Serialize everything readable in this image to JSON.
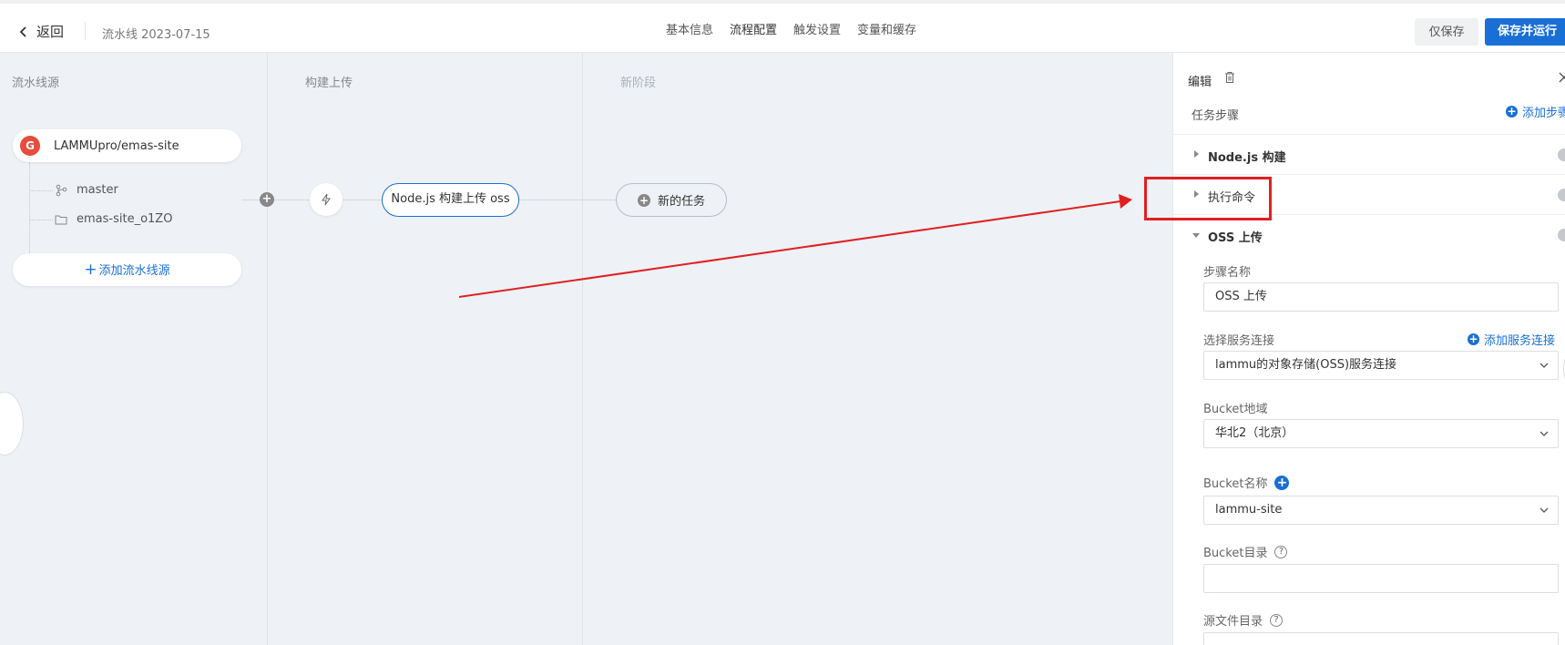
{
  "header": {
    "back_label": "返回",
    "pipeline_name": "流水线 2023-07-15",
    "tabs": [
      {
        "label": "基本信息"
      },
      {
        "label": "流程配置"
      },
      {
        "label": "触发设置"
      },
      {
        "label": "变量和缓存"
      }
    ],
    "active_tab": "流程配置",
    "save_only_label": "仅保存",
    "save_run_label": "保存并运行"
  },
  "canvas": {
    "stages": [
      {
        "title": "流水线源"
      },
      {
        "title": "构建上传"
      },
      {
        "title": "新阶段"
      }
    ],
    "source": {
      "logo_letter": "G",
      "repo": "LAMMUpro/emas-site",
      "branch": "master",
      "workdir": "emas-site_o1ZO"
    },
    "add_source_label": "添加流水线源",
    "task_label": "Node.js 构建上传 oss",
    "new_task_label": "新的任务"
  },
  "panel": {
    "title": "编辑",
    "steps_header": "任务步骤",
    "add_step_label": "添加步骤",
    "steps": [
      {
        "label": "Node.js 构建"
      },
      {
        "label": "执行命令"
      },
      {
        "label": "OSS 上传"
      }
    ],
    "form": {
      "step_name_label": "步骤名称",
      "step_name_value": "OSS 上传",
      "service_label": "选择服务连接",
      "add_service_label": "添加服务连接",
      "service_value": "lammu的对象存储(OSS)服务连接",
      "region_label": "Bucket地域",
      "region_value": "华北2（北京）",
      "bucket_name_label": "Bucket名称",
      "bucket_name_value": "lammu-site",
      "bucket_dir_label": "Bucket目录",
      "bucket_dir_value": "",
      "src_dir_label": "源文件目录"
    }
  },
  "colors": {
    "accent": "#1a6fd6",
    "annotation": "#e02020",
    "canvas_bg": "#eef1f5"
  }
}
